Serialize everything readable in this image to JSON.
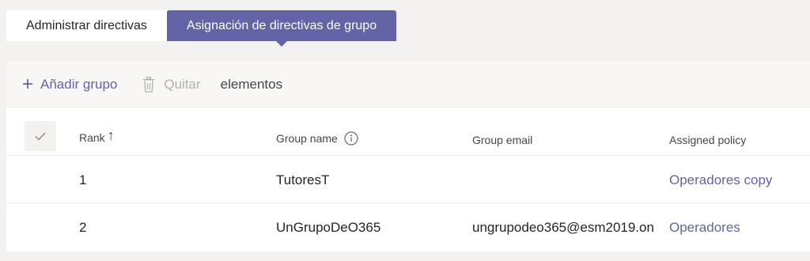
{
  "tabs": [
    {
      "label": "Administrar directivas",
      "active": false
    },
    {
      "label": "Asignación de directivas de grupo",
      "active": true
    }
  ],
  "toolbar": {
    "add_label": "Añadir grupo",
    "remove_label": "Quitar",
    "count_label": "elementos"
  },
  "table": {
    "columns": {
      "rank": "Rank",
      "name": "Group name",
      "email": "Group email",
      "policy": "Assigned policy"
    },
    "rows": [
      {
        "rank": "1",
        "name": "TutoresT",
        "email": "",
        "policy": "Operadores copy"
      },
      {
        "rank": "2",
        "name": "UnGrupoDeO365",
        "email": "ungrupodeo365@esm2019.on",
        "policy": "Operadores"
      }
    ]
  },
  "colors": {
    "accent": "#6264a7",
    "disabled": "#b3b0ad",
    "background": "#f3f2f1"
  }
}
